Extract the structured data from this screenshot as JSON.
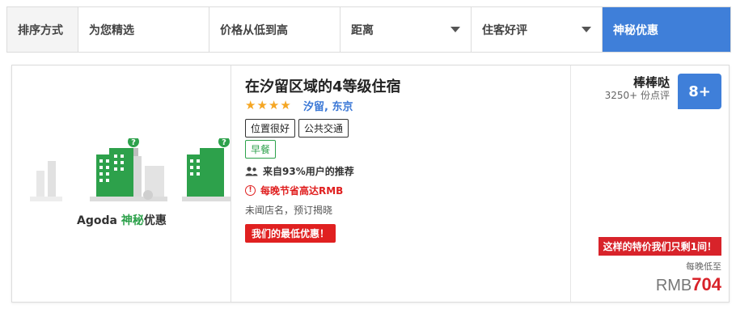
{
  "sortbar": {
    "label": "排序方式",
    "options": [
      {
        "label": "为您精选",
        "dropdown": false,
        "active": false
      },
      {
        "label": "价格从低到高",
        "dropdown": false,
        "active": false
      },
      {
        "label": "距离",
        "dropdown": true,
        "active": false
      },
      {
        "label": "住客好评",
        "dropdown": true,
        "active": false
      },
      {
        "label": "神秘优惠",
        "dropdown": false,
        "active": true
      }
    ]
  },
  "listing": {
    "brand_prefix": "Agoda ",
    "brand_green": "神秘",
    "brand_suffix": "优惠",
    "title": "在汐留区域的4等级住宿",
    "stars": "★★★★",
    "location": "汐留, 东京",
    "tags": [
      "位置很好",
      "公共交通"
    ],
    "green_tag": "早餐",
    "recommendation": "来自93%用户的推荐",
    "savings": "每晚节省高达RMB",
    "anonymous_note": "未闻店名，预订揭晓",
    "lowest_badge": "我们的最低优惠！",
    "review_word": "棒棒哒",
    "review_count": "3250+ 份点评",
    "score": "8+",
    "urgent_badge": "这样的特价我们只剩1间！",
    "per_night_label": "每晚低至",
    "currency": "RMB",
    "price": "704"
  },
  "colors": {
    "accent_blue": "#3f7fd9",
    "brand_green": "#2da14b",
    "alert_red": "#e02020",
    "star_orange": "#f5a623"
  },
  "icons": {
    "users": "users-icon",
    "alert": "exclamation-circle-icon",
    "dropdown": "caret-down-icon",
    "question": "question-mark-icon"
  }
}
